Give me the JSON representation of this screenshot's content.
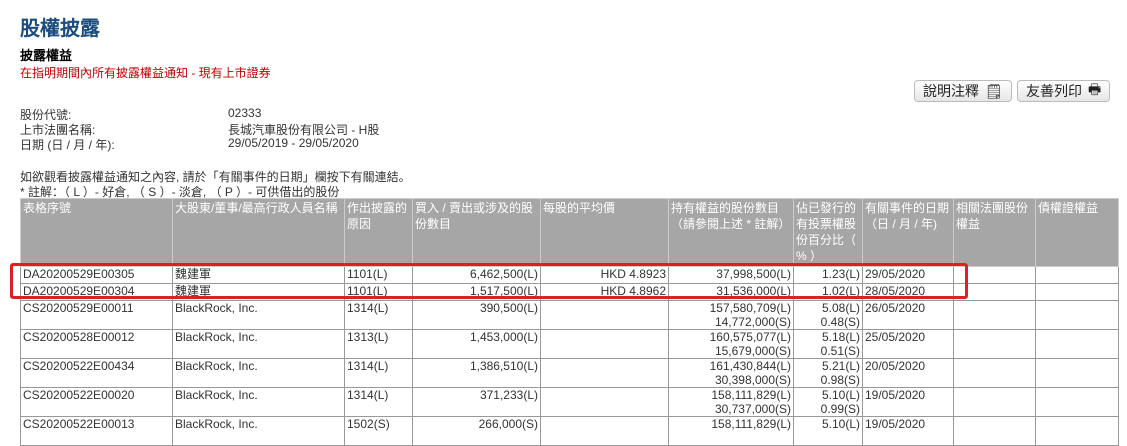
{
  "page": {
    "title": "股權披露",
    "subtitle": "披露權益",
    "notice": "在指明期間內所有披露權益通知 - 現有上市證券"
  },
  "buttons": {
    "notes": "說明注釋",
    "print": "友善列印"
  },
  "info": {
    "code_label": "股份代號:",
    "code": "02333",
    "name_label": "上市法團名稱:",
    "name": "長城汽車股份有限公司 - H股",
    "date_label": "日期 (日 / 月 / 年):",
    "date": "29/05/2019 - 29/05/2020",
    "instruction": "如欲觀看披露權益通知之內容, 請於「有關事件的日期」欄按下有關連結。",
    "legend": " * 註解：（ L ）- 好倉, （ S ）- 淡倉, （ P ）- 可供借出的股份"
  },
  "table": {
    "headers": [
      "表格序號",
      "大股東/董事/最高行政人員名稱",
      "作出披露的原因",
      "買入 / 賣出或涉及的股份數目",
      "每股的平均價",
      "持有權益的股份數目（請參閱上述 * 註解）",
      "佔已發行的有投票權股份百分比（ % ）",
      "有關事件的日期（日 / 月 / 年)",
      "相關法團股份權益",
      "債權證權益"
    ],
    "rows": [
      {
        "id": "DA20200529E00305",
        "name": "魏建軍",
        "reason": "1101(L)",
        "shares": "6,462,500(L)",
        "price": "HKD 4.8923",
        "held": [
          "37,998,500(L)"
        ],
        "pct": [
          "1.23(L)"
        ],
        "date": "29/05/2020"
      },
      {
        "id": "DA20200529E00304",
        "name": "魏建軍",
        "reason": "1101(L)",
        "shares": "1,517,500(L)",
        "price": "HKD 4.8962",
        "held": [
          "31,536,000(L)"
        ],
        "pct": [
          "1.02(L)"
        ],
        "date": "28/05/2020"
      },
      {
        "id": "CS20200529E00011",
        "name": "BlackRock, Inc.",
        "reason": "1314(L)",
        "shares": "390,500(L)",
        "price": "",
        "held": [
          "157,580,709(L)",
          "14,772,000(S)"
        ],
        "pct": [
          "5.08(L)",
          "0.48(S)"
        ],
        "date": "26/05/2020"
      },
      {
        "id": "CS20200528E00012",
        "name": "BlackRock, Inc.",
        "reason": "1313(L)",
        "shares": "1,453,000(L)",
        "price": "",
        "held": [
          "160,575,077(L)",
          "15,679,000(S)"
        ],
        "pct": [
          "5.18(L)",
          "0.51(S)"
        ],
        "date": "25/05/2020"
      },
      {
        "id": "CS20200522E00434",
        "name": "BlackRock, Inc.",
        "reason": "1314(L)",
        "shares": "1,386,510(L)",
        "price": "",
        "held": [
          "161,430,844(L)",
          "30,398,000(S)"
        ],
        "pct": [
          "5.21(L)",
          "0.98(S)"
        ],
        "date": "20/05/2020"
      },
      {
        "id": "CS20200522E00020",
        "name": "BlackRock, Inc.",
        "reason": "1314(L)",
        "shares": "371,233(L)",
        "price": "",
        "held": [
          "158,111,829(L)",
          "30,737,000(S)"
        ],
        "pct": [
          "5.10(L)",
          "0.99(S)"
        ],
        "date": "19/05/2020"
      },
      {
        "id": "CS20200522E00013",
        "name": "BlackRock, Inc.",
        "reason": "1502(S)",
        "shares": "266,000(S)",
        "price": "",
        "held": [
          "158,111,829(L)"
        ],
        "pct": [
          "5.10(L)"
        ],
        "date": "19/05/2020"
      }
    ]
  },
  "colors": {
    "title": "#1c4d7e",
    "notice": "#c00000",
    "header_bg": "#a6a6a6",
    "highlight": "#e02020"
  }
}
